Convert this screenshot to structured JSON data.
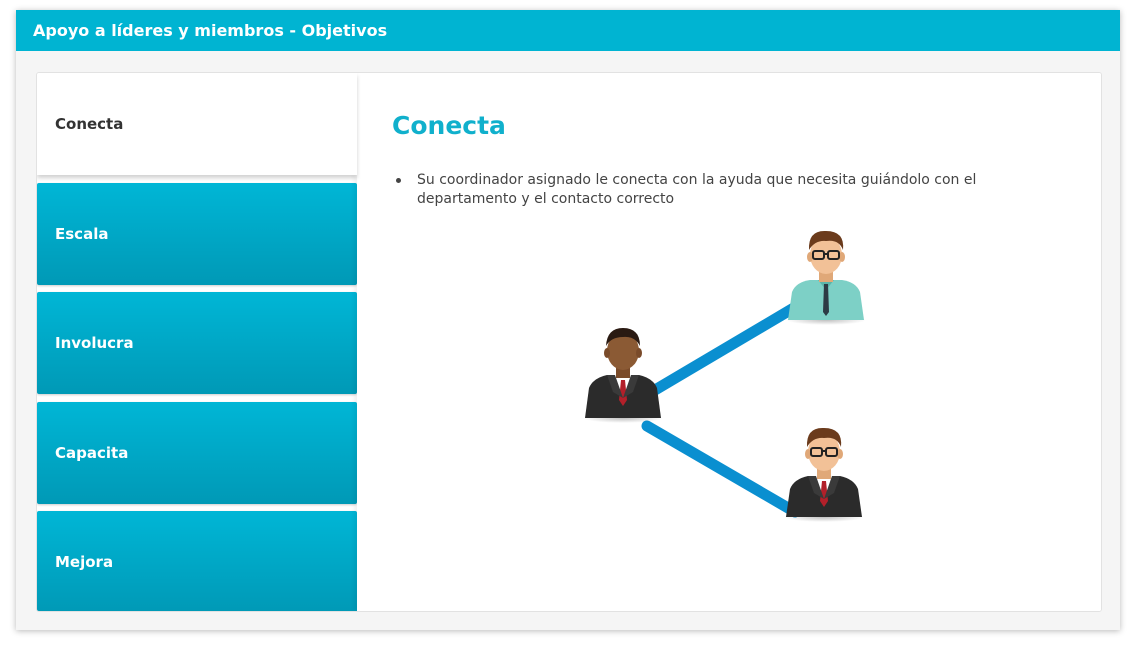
{
  "window": {
    "title": "Apoyo a líderes y miembros - Objetivos"
  },
  "tabs": [
    {
      "label": "Conecta",
      "active": true
    },
    {
      "label": "Escala",
      "active": false
    },
    {
      "label": "Involucra",
      "active": false
    },
    {
      "label": "Capacita",
      "active": false
    },
    {
      "label": "Mejora",
      "active": false
    }
  ],
  "content": {
    "heading": "Conecta",
    "bullets": [
      "Su coordinador asignado le conecta con la ayuda que necesita guiándolo con el departamento y el contacto correcto"
    ]
  },
  "colors": {
    "accent": "#00b4d2",
    "heading": "#10b0cc",
    "connector": "#0a8fd0"
  }
}
